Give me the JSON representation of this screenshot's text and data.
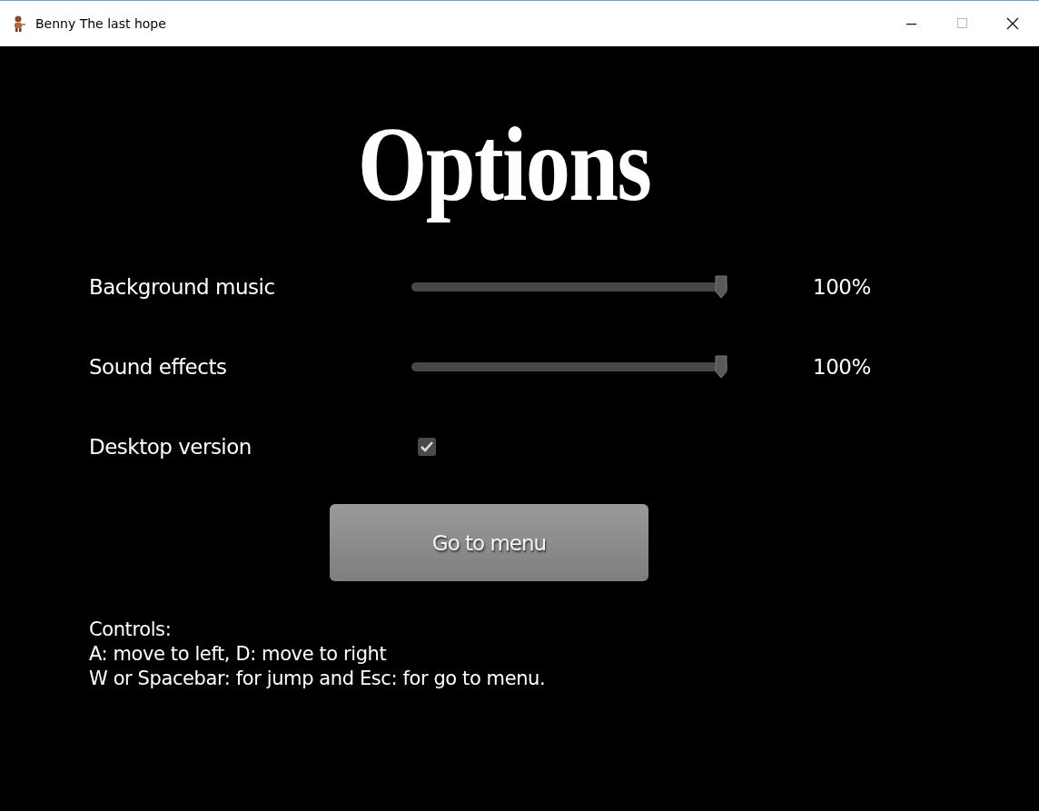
{
  "window": {
    "title": "Benny The last hope"
  },
  "heading": "Options",
  "settings": [
    {
      "kind": "slider",
      "label": "Background music",
      "level": 1,
      "reading": "100%"
    },
    {
      "kind": "slider",
      "label": "Sound effects",
      "level": 1,
      "reading": "100%"
    },
    {
      "kind": "checkbox",
      "label": "Desktop version",
      "checked": true
    }
  ],
  "button": "Go to menu",
  "controls_help": [
    "Controls:",
    "A: move to left, D: move to right",
    "W or Spacebar: for jump and Esc: for go to menu."
  ]
}
